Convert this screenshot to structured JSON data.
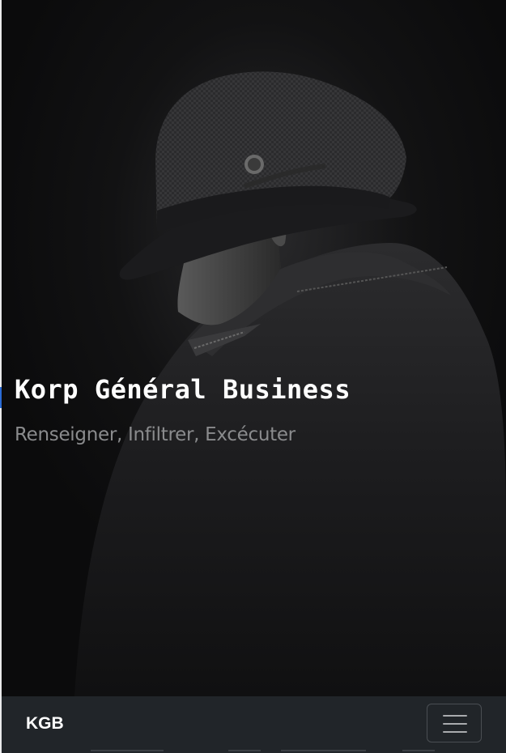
{
  "hero": {
    "title": "Korp Général Business",
    "subtitle": "Renseigner, Infiltrer, Excécuter",
    "image_icon": "man-in-fedora-hat-image"
  },
  "navbar": {
    "brand": "KGB",
    "toggler_icon": "hamburger-menu-icon"
  },
  "colors": {
    "hero_background": "#0c0c0d",
    "navbar_background": "#212529",
    "title": "#ffffff",
    "subtitle": "#8a8b8d"
  }
}
